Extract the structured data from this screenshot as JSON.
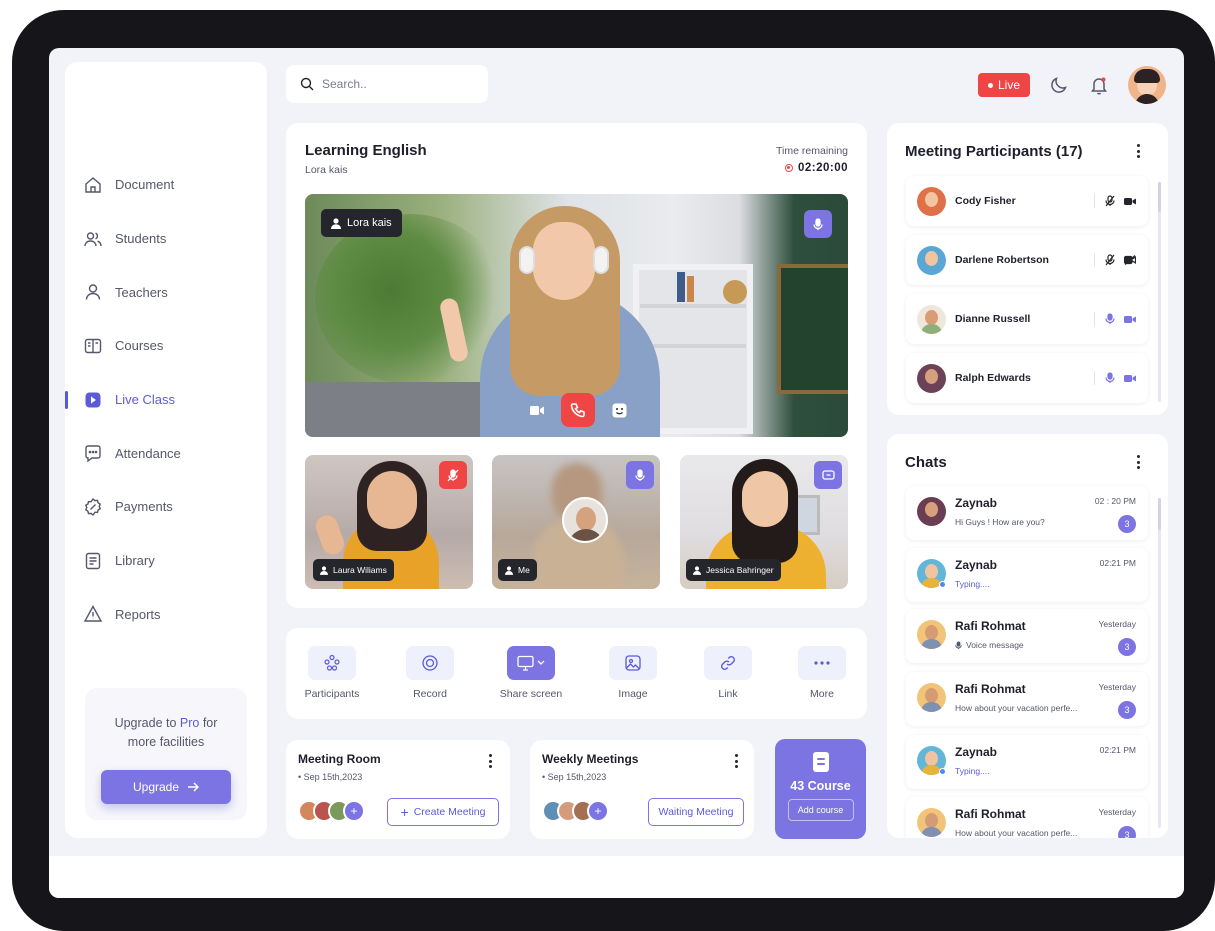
{
  "search": {
    "placeholder": "Search.."
  },
  "topbar": {
    "live_label": "Live"
  },
  "sidebar": {
    "items": [
      {
        "label": "Document",
        "icon": "home-icon"
      },
      {
        "label": "Students",
        "icon": "users-icon"
      },
      {
        "label": "Teachers",
        "icon": "user-icon"
      },
      {
        "label": "Courses",
        "icon": "book-icon"
      },
      {
        "label": "Live Class",
        "icon": "play-icon",
        "active": true
      },
      {
        "label": "Attendance",
        "icon": "chat-dots-icon"
      },
      {
        "label": "Payments",
        "icon": "payment-icon"
      },
      {
        "label": "Library",
        "icon": "document-icon"
      },
      {
        "label": "Reports",
        "icon": "warning-icon"
      }
    ],
    "upgrade": {
      "text_before": "Upgrade to ",
      "pro": "Pro",
      "text_after": " for more facilities",
      "button": "Upgrade"
    }
  },
  "class": {
    "title": "Learning English",
    "teacher": "Lora kais",
    "time_label": "Time remaining",
    "time_value": "02:20:00",
    "main_video_name": "Lora kais",
    "thumbs": [
      {
        "name": "Laura Wiliams",
        "status": "muted"
      },
      {
        "name": "Me",
        "status": "mic-on"
      },
      {
        "name": "Jessica Bahringer",
        "status": "screen"
      }
    ]
  },
  "tools": [
    {
      "label": "Participants",
      "icon": "participants-icon"
    },
    {
      "label": "Record",
      "icon": "record-icon"
    },
    {
      "label": "Share screen",
      "icon": "monitor-icon",
      "active": true
    },
    {
      "label": "Image",
      "icon": "image-icon"
    },
    {
      "label": "Link",
      "icon": "link-icon"
    },
    {
      "label": "More",
      "icon": "more-icon"
    }
  ],
  "meetings": [
    {
      "title": "Meeting Room",
      "date": "• Sep 15th,2023",
      "button": "Create Meeting"
    },
    {
      "title": "Weekly Meetings",
      "date": "• Sep 15th,2023",
      "button": "Waiting Meeting"
    }
  ],
  "course": {
    "count": "43 Course",
    "button": "Add course"
  },
  "participants": {
    "title": "Meeting Participants (17)",
    "list": [
      {
        "name": "Cody Fisher",
        "mic": "off",
        "cam": "on"
      },
      {
        "name": "Darlene Robertson",
        "mic": "off",
        "cam": "off"
      },
      {
        "name": "Dianne Russell",
        "mic": "on",
        "cam": "on"
      },
      {
        "name": "Ralph Edwards",
        "mic": "on",
        "cam": "on"
      }
    ]
  },
  "chats": {
    "title": "Chats",
    "list": [
      {
        "name": "Zaynab",
        "message": "Hi Guys ! How are you?",
        "time": "02 : 20 PM",
        "badge": "3"
      },
      {
        "name": "Zaynab",
        "message": "Typing....",
        "time": "02:21 PM",
        "typing": true
      },
      {
        "name": "Rafi Rohmat",
        "message": "Voice message",
        "time": "Yesterday",
        "badge": "3",
        "voice": true
      },
      {
        "name": "Rafi Rohmat",
        "message": "How about your vacation perfe...",
        "time": "Yesterday",
        "badge": "3"
      },
      {
        "name": "Zaynab",
        "message": "Typing....",
        "time": "02:21 PM",
        "typing": true
      },
      {
        "name": "Rafi Rohmat",
        "message": "How about your vacation perfe...",
        "time": "Yesterday",
        "badge": "3"
      }
    ]
  },
  "colors": {
    "accent": "#7b74e2",
    "live": "#f04545",
    "frame": "#16161a",
    "background": "#f2f3f8"
  }
}
